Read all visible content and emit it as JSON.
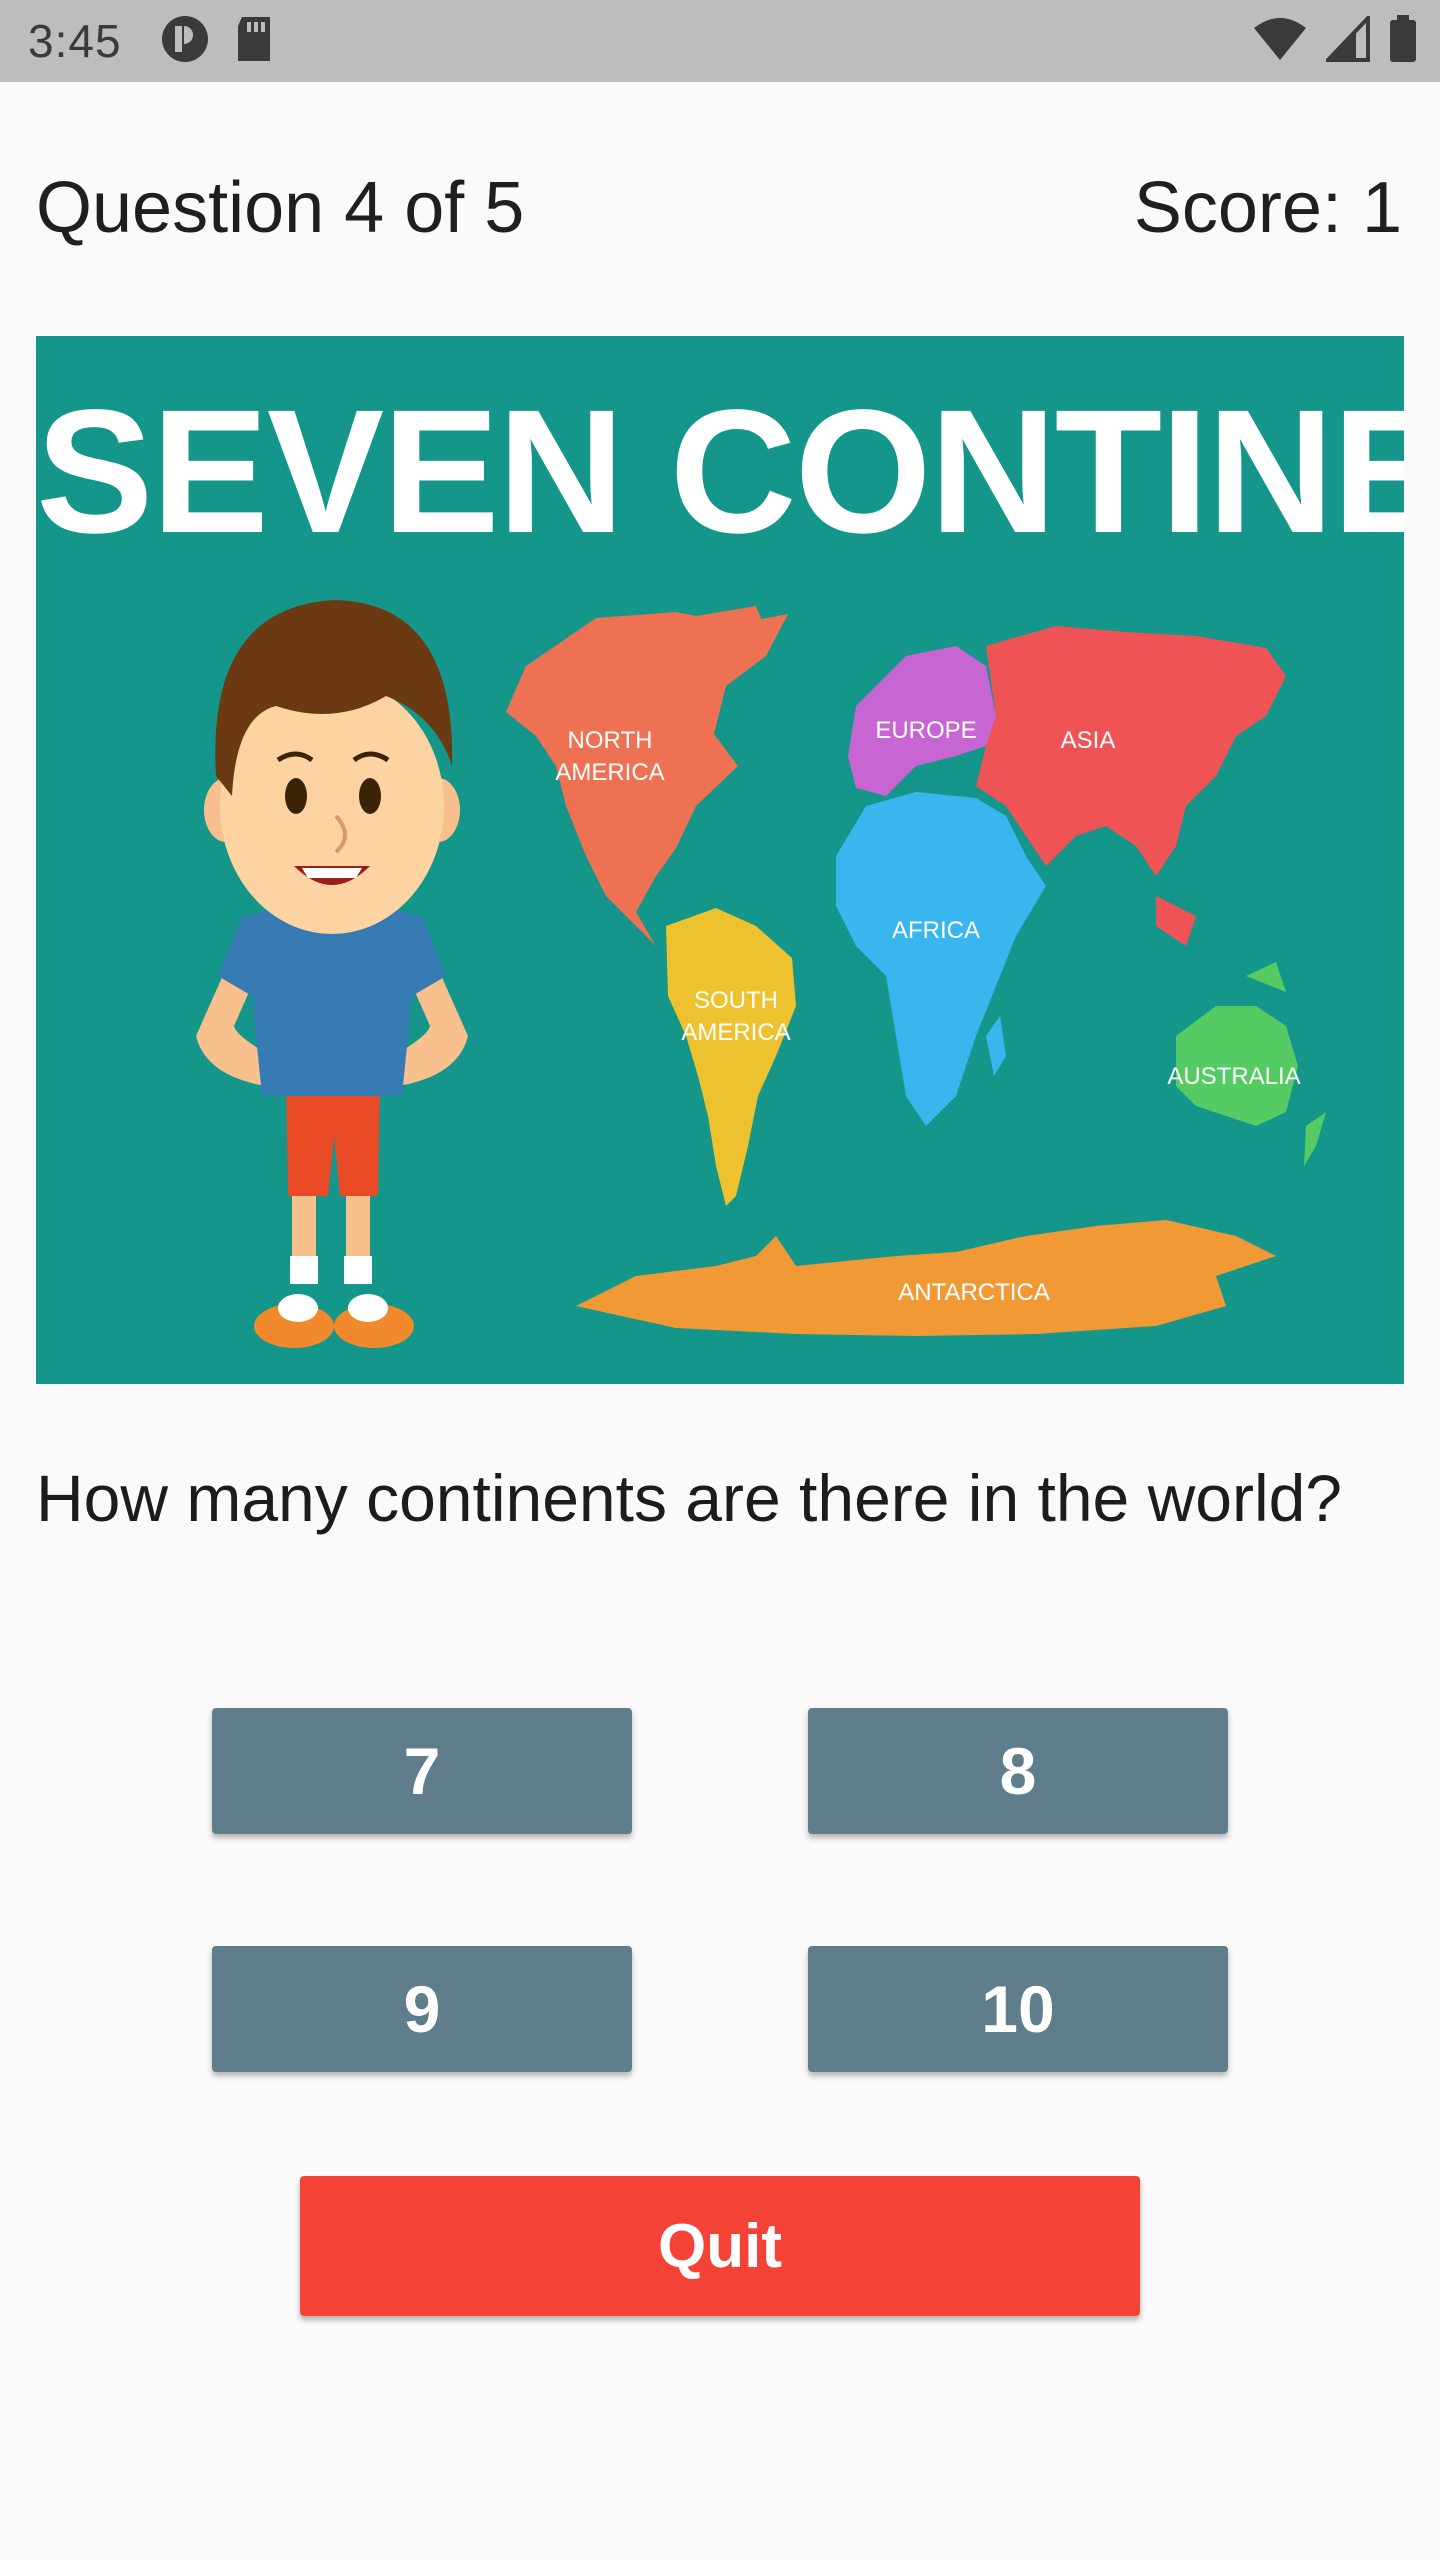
{
  "status_bar": {
    "time": "3:45",
    "icons": [
      "app-notification-icon",
      "sd-card-icon",
      "wifi-icon",
      "cell-signal-icon",
      "battery-icon"
    ]
  },
  "header": {
    "question_counter": "Question 4 of 5",
    "score": "Score: 1"
  },
  "illustration": {
    "title": "SEVEN CONTINENTS",
    "labels": {
      "north_america_1": "NORTH",
      "north_america_2": "AMERICA",
      "south_america_1": "SOUTH",
      "south_america_2": "AMERICA",
      "europe": "EUROPE",
      "asia": "ASIA",
      "africa": "AFRICA",
      "australia": "AUSTRALIA",
      "antarctica": "ANTARCTICA"
    },
    "colors": {
      "background": "#14968a",
      "north_america": "#ee7153",
      "south_america": "#eec12e",
      "europe": "#c765d2",
      "asia": "#ef5356",
      "africa": "#39b6ee",
      "australia": "#55cc63",
      "antarctica": "#f19a35"
    }
  },
  "question": {
    "text": "How many continents are there in the world?"
  },
  "answers": [
    "7",
    "8",
    "9",
    "10"
  ],
  "quit_label": "Quit",
  "colors": {
    "answer_button": "#607d8b",
    "quit_button": "#f44336",
    "status_bar": "#bdbdbd",
    "background": "#fafafa"
  }
}
